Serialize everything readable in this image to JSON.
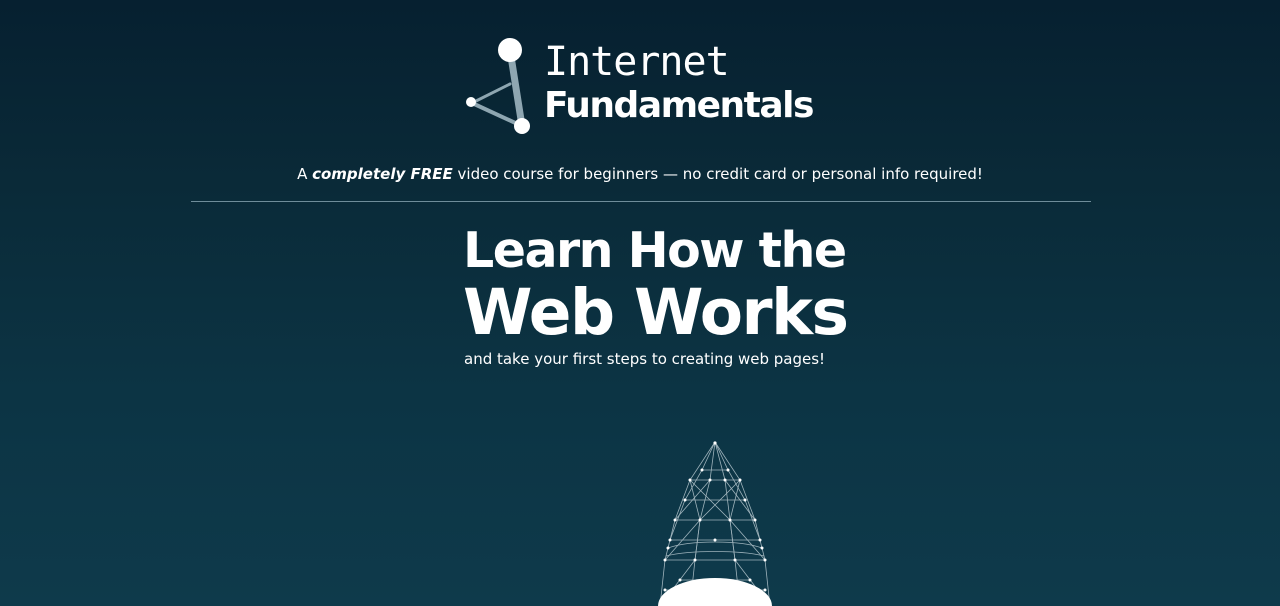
{
  "logo": {
    "line1": "Internet",
    "line2": "Fundamentals"
  },
  "tagline": {
    "prefix": "A ",
    "emphasis": "completely FREE",
    "suffix": " video course for beginners — no credit card or personal info required!"
  },
  "hero": {
    "headline_line1": "Learn How the",
    "headline_line2": "Web Works",
    "subheadline": "and take your first steps to creating web pages!"
  },
  "icons": {
    "logo_mark": "network-nodes-icon",
    "hero_graphic": "wireframe-rocket-icon"
  },
  "colors": {
    "background_top": "#062030",
    "background_bottom": "#0e3a4b",
    "text": "#ffffff",
    "divider": "#6f8d9a"
  }
}
